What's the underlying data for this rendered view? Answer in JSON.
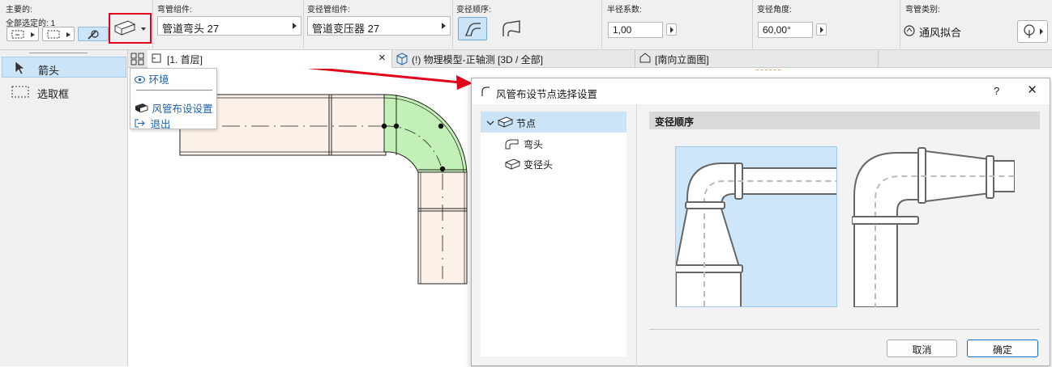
{
  "infobox": {
    "main": {
      "label": "主要的:",
      "selection_text": "全部选定的: 1"
    },
    "elbow_part": {
      "label": "弯管组件:",
      "value": "管道弯头 27"
    },
    "transition_part": {
      "label": "变径管组件:",
      "value": "管道变压器 27"
    },
    "transition_order": {
      "label": "变径顺序:"
    },
    "radius_factor": {
      "label": "半径系数:",
      "value": "1,00"
    },
    "transition_angle": {
      "label": "变径角度:",
      "value": "60,00°"
    },
    "elbow_type": {
      "label": "弯管类别:",
      "value": "通风拟合"
    }
  },
  "toolbox": {
    "items": [
      {
        "label": "箭头",
        "icon": "arrow-cursor-icon",
        "selected": true
      },
      {
        "label": "选取框",
        "icon": "marquee-icon",
        "selected": false
      }
    ]
  },
  "tabs": [
    {
      "label": "[1. 首层]",
      "icon": "floor-plan-icon",
      "active": true,
      "close": "×"
    },
    {
      "label": "(!) 物理模型-正轴测 [3D / 全部]",
      "icon": "cube-3d-icon",
      "active": false
    },
    {
      "label": "[南向立面图]",
      "icon": "elevation-icon",
      "active": false
    }
  ],
  "popup_menu": {
    "items": [
      {
        "label": "环境",
        "icon": "eye-icon"
      },
      {
        "label": "风管布设设置",
        "icon": "duct-settings-icon"
      },
      {
        "label": "退出",
        "icon": "exit-icon"
      }
    ]
  },
  "dialog": {
    "title": "风管布设节点选择设置",
    "help": "?",
    "close": "×",
    "tree": {
      "root": "节点",
      "children": [
        "弯头",
        "变径头"
      ]
    },
    "section_title": "变径顺序",
    "buttons": {
      "cancel": "取消",
      "ok": "确定"
    }
  },
  "colors": {
    "accent": "#0b6dc7",
    "highlight_red": "#e3001b",
    "selected_blue": "#cce4f7",
    "duct_fill": "#fcf1e8",
    "elbow_fill": "#c3f0b6",
    "option_selected_bg": "#cde6fa"
  }
}
